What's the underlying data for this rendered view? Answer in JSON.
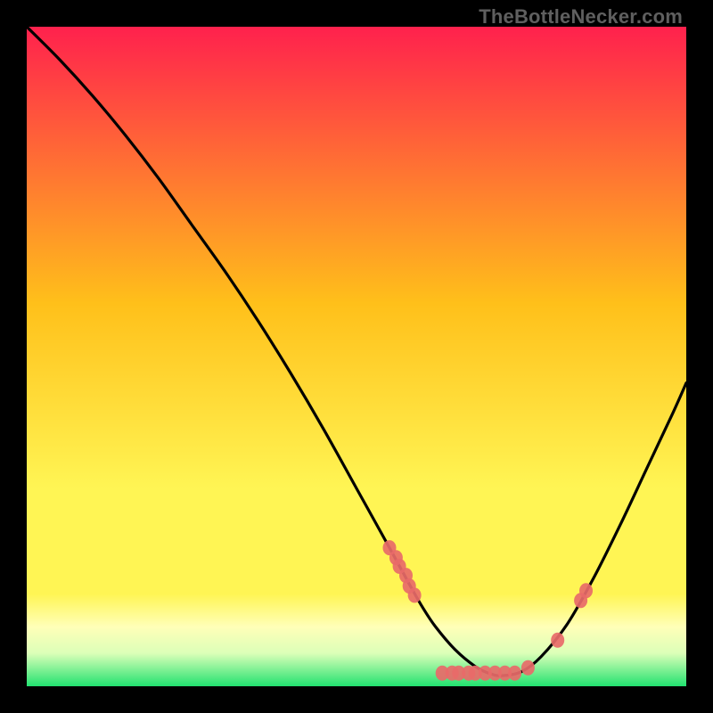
{
  "watermark": "TheBottleNecker.com",
  "chart_data": {
    "type": "line",
    "title": "",
    "xlabel": "",
    "ylabel": "",
    "xlim": [
      0,
      100
    ],
    "ylim": [
      0,
      100
    ],
    "gradient_colors": {
      "top": "#ff214d",
      "upper_mid": "#ffc01a",
      "lower_mid": "#fff554",
      "pale": "#ffffb8",
      "bottom": "#22e270"
    },
    "series": [
      {
        "name": "curve",
        "x": [
          0,
          5,
          10,
          15,
          20,
          25,
          30,
          35,
          40,
          45,
          50,
          55,
          58,
          60,
          62,
          65,
          68,
          70,
          72,
          75,
          78,
          82,
          86,
          90,
          94,
          98,
          100
        ],
        "y": [
          100,
          95,
          89.5,
          83.5,
          77,
          70,
          63,
          55.5,
          47.5,
          39,
          30,
          21,
          15.5,
          12,
          9,
          5.5,
          3,
          2,
          1.6,
          2.2,
          4.5,
          9.5,
          16.5,
          24.5,
          33,
          41.5,
          46
        ]
      }
    ],
    "markers": [
      {
        "x": 55.0,
        "y": 21.0
      },
      {
        "x": 56.0,
        "y": 19.5
      },
      {
        "x": 56.5,
        "y": 18.2
      },
      {
        "x": 57.5,
        "y": 16.8
      },
      {
        "x": 58.0,
        "y": 15.2
      },
      {
        "x": 58.8,
        "y": 13.8
      },
      {
        "x": 63.0,
        "y": 2.0
      },
      {
        "x": 64.5,
        "y": 2.0
      },
      {
        "x": 65.5,
        "y": 2.0
      },
      {
        "x": 67.0,
        "y": 2.0
      },
      {
        "x": 68.0,
        "y": 2.0
      },
      {
        "x": 69.5,
        "y": 2.0
      },
      {
        "x": 71.0,
        "y": 2.0
      },
      {
        "x": 72.5,
        "y": 2.0
      },
      {
        "x": 74.0,
        "y": 2.0
      },
      {
        "x": 76.0,
        "y": 2.8
      },
      {
        "x": 80.5,
        "y": 7.0
      },
      {
        "x": 84.0,
        "y": 13.0
      },
      {
        "x": 84.8,
        "y": 14.5
      }
    ],
    "marker_color": "#e86a69",
    "curve_color": "#000000"
  }
}
